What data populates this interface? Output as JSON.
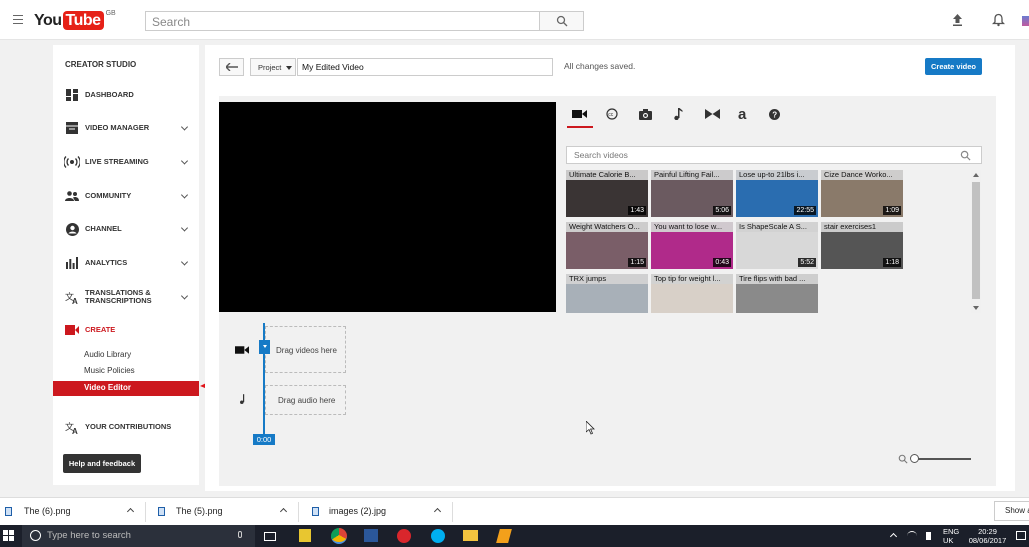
{
  "header": {
    "logo_you": "You",
    "logo_tube": "Tube",
    "logo_region": "GB",
    "search_placeholder": "Search"
  },
  "sidebar": {
    "title": "CREATOR STUDIO",
    "items": [
      {
        "label": "DASHBOARD",
        "icon": "dashboard-icon",
        "chevron": false
      },
      {
        "label": "VIDEO MANAGER",
        "icon": "video-manager-icon",
        "chevron": true
      },
      {
        "label": "LIVE STREAMING",
        "icon": "live-streaming-icon",
        "chevron": true
      },
      {
        "label": "COMMUNITY",
        "icon": "community-icon",
        "chevron": true
      },
      {
        "label": "CHANNEL",
        "icon": "channel-icon",
        "chevron": true
      },
      {
        "label": "ANALYTICS",
        "icon": "analytics-icon",
        "chevron": true
      },
      {
        "label": "TRANSLATIONS &",
        "label2": "TRANSCRIPTIONS",
        "icon": "translate-icon",
        "chevron": true
      },
      {
        "label": "CREATE",
        "icon": "create-icon",
        "chevron": false
      }
    ],
    "create_subitems": [
      "Audio Library",
      "Music Policies",
      "Video Editor"
    ],
    "contributions": "YOUR CONTRIBUTIONS",
    "help": "Help and feedback",
    "accent": "#cc181e"
  },
  "editor": {
    "project_label": "Project",
    "project_name": "My Edited Video",
    "status": "All changes saved.",
    "create_button": "Create video",
    "search_placeholder": "Search videos",
    "drag_videos": "Drag videos here",
    "drag_audio": "Drag audio here",
    "playhead_time": "0:00",
    "tabs": [
      "video-camera-icon",
      "creative-commons-icon",
      "photo-icon",
      "music-note-icon",
      "transitions-icon",
      "text-icon",
      "help-icon"
    ],
    "videos": [
      {
        "title": "Ultimate Calorie B...",
        "duration": "1:43",
        "color": "#3a3434"
      },
      {
        "title": "Painful Lifting Fail...",
        "duration": "5:06",
        "color": "#6b5a60"
      },
      {
        "title": "Lose up-to 21lbs i...",
        "duration": "22:55",
        "color": "#2a6db0"
      },
      {
        "title": "Cize Dance Worko...",
        "duration": "1:09",
        "color": "#8a7a6a"
      },
      {
        "title": "Weight Watchers O...",
        "duration": "1:15",
        "color": "#7a5e68"
      },
      {
        "title": "You want to lose w...",
        "duration": "0:43",
        "color": "#b02a8a"
      },
      {
        "title": "Is ShapeScale A S...",
        "duration": "5:52",
        "color": "#d8d8d8"
      },
      {
        "title": "stair exercises1",
        "duration": "1:18",
        "color": "#555"
      },
      {
        "title": "TRX jumps",
        "duration": "",
        "color": "#a8b0b8"
      },
      {
        "title": "Top tip for weight l...",
        "duration": "",
        "color": "#d8d0c8"
      },
      {
        "title": "Tire flips with bad ...",
        "duration": "",
        "color": "#8a8a8a"
      }
    ]
  },
  "downloads": [
    {
      "name": "The (6).png"
    },
    {
      "name": "The (5).png"
    },
    {
      "name": "images (2).jpg"
    }
  ],
  "downloads_showall": "Show a",
  "taskbar": {
    "search_placeholder": "Type here to search",
    "language": "ENG",
    "region": "UK",
    "time": "20:29",
    "date": "08/06/2017"
  }
}
